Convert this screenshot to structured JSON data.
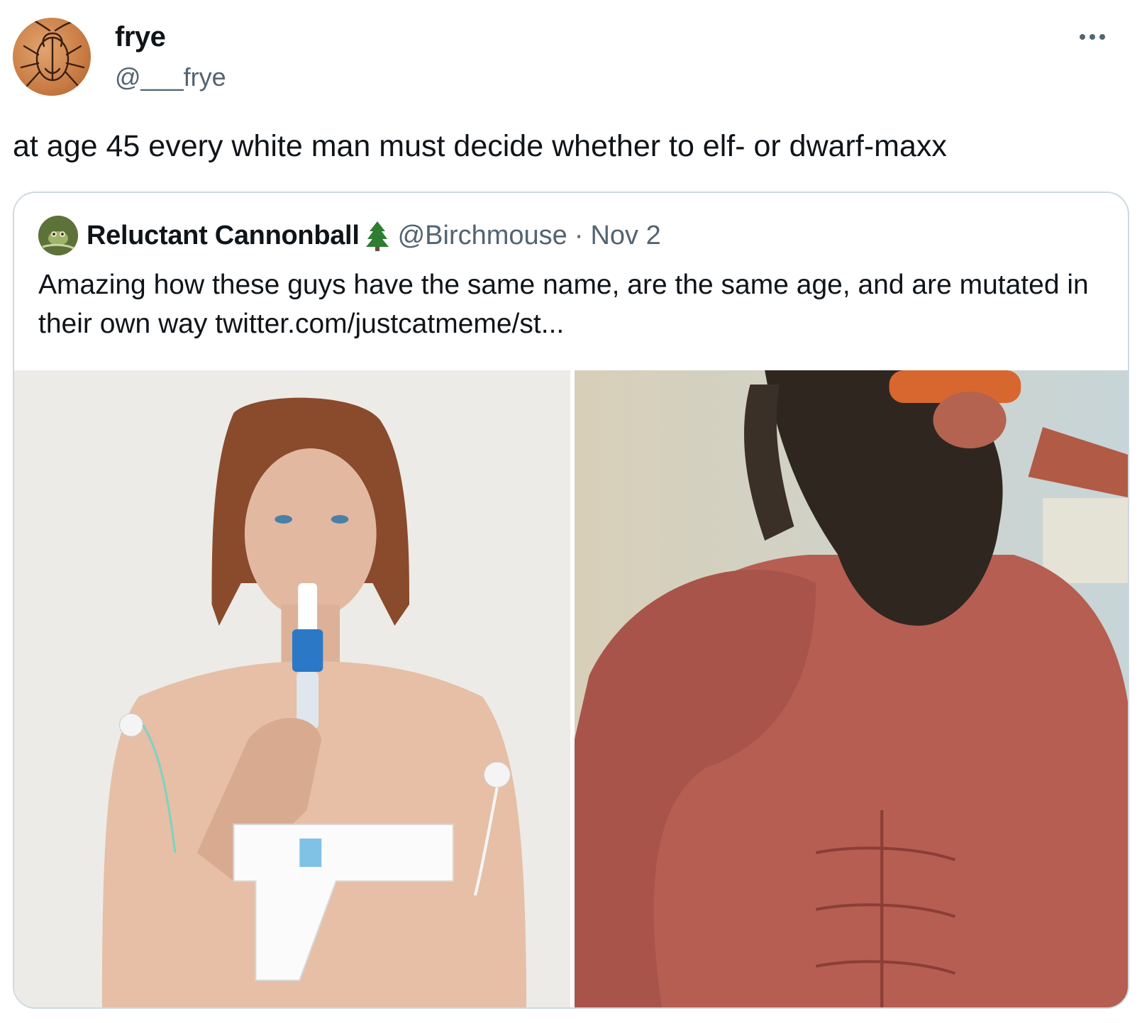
{
  "author": {
    "display_name": "frye",
    "handle": "@___frye",
    "avatar_icon": "cockroach-sketch-avatar"
  },
  "tweet": {
    "text": "at age 45 every white man must decide whether to elf- or dwarf-maxx"
  },
  "more_icon": "more-horizontal-icon",
  "quoted": {
    "display_name": "Reluctant Cannonball",
    "badge_emoji": "evergreen-tree-icon",
    "handle": "@Birchmouse",
    "separator": "·",
    "date": "Nov 2",
    "text": "Amazing how these guys have the same name, are the same age, and are mutated in their own way ",
    "link": "twitter.com/justcatmeme/st...",
    "media": [
      {
        "kind": "photo",
        "subject": "slim man with long auburn hair using a nebulizer with chest monitors"
      },
      {
        "kind": "photo",
        "subject": "muscular bodybuilder with long curly beard and orange sunglasses"
      }
    ]
  },
  "colors": {
    "text": "#0f1419",
    "secondary": "#536471",
    "border": "#cfd9de"
  }
}
